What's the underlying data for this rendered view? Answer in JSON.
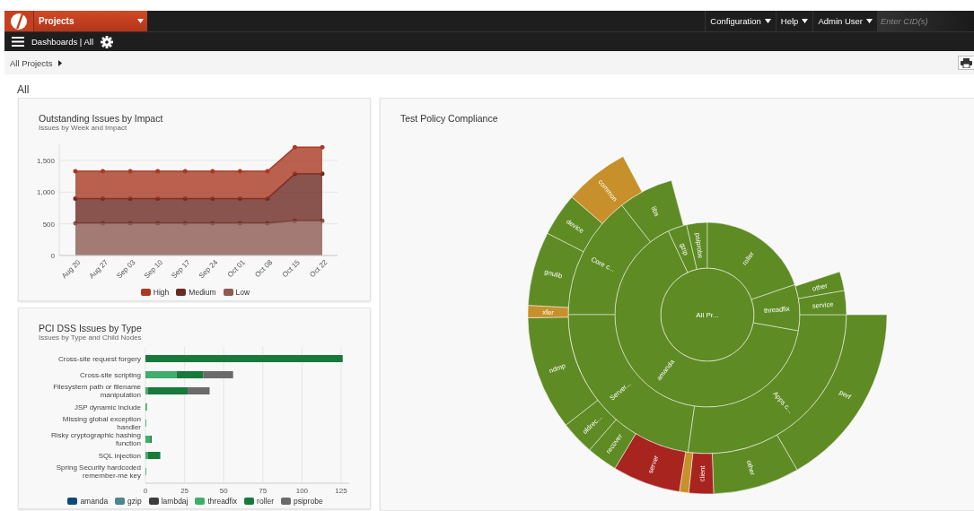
{
  "topbar": {
    "project_menu": "Projects",
    "menus": [
      "Configuration",
      "Help",
      "Admin User"
    ],
    "cid_field": {
      "placeholder": "Enter CID(s)"
    }
  },
  "subbar": {
    "title": "Dashboards | All"
  },
  "breadcrumb": {
    "label": "All Projects"
  },
  "page_title": "All",
  "impact_panel": {
    "title": "Outstanding Issues by Impact",
    "subtitle": "Issues by Week and Impact",
    "chart_data": {
      "type": "area",
      "stacked": true,
      "grid": true,
      "legend": "bottom",
      "categories": [
        "Aug 20",
        "Aug 27",
        "Sep 03",
        "Sep 10",
        "Sep 17",
        "Sep 24",
        "Oct 01",
        "Oct 08",
        "Oct 15",
        "Oct 22"
      ],
      "ylim": [
        0,
        1750
      ],
      "yticks": [
        0,
        {
          "value": 500,
          "label": "500"
        },
        {
          "value": 1000,
          "label": "1,000"
        },
        {
          "value": 1500,
          "label": "1,500"
        }
      ],
      "series": [
        {
          "name": "High",
          "color": "#a93a24",
          "values": [
            430,
            430,
            430,
            430,
            430,
            430,
            430,
            430,
            420,
            420
          ]
        },
        {
          "name": "Medium",
          "color": "#6b2b22",
          "values": [
            390,
            390,
            390,
            390,
            390,
            390,
            390,
            390,
            740,
            740
          ]
        },
        {
          "name": "Low",
          "color": "#8e5a52",
          "values": [
            510,
            510,
            510,
            510,
            510,
            510,
            510,
            510,
            550,
            550
          ]
        }
      ]
    }
  },
  "pci_panel": {
    "title": "PCI DSS Issues by Type",
    "subtitle": "Issues by Type and Child Nodes",
    "chart_data": {
      "type": "bar",
      "orientation": "horizontal",
      "stacked": true,
      "grid": true,
      "legend": "bottom",
      "categories": [
        "Cross-site request forgery",
        "Cross-site scripting",
        "Filesystem path or filename manipulation",
        "JSP dynamic include",
        "Missing global exception handler",
        "Risky cryptographic hashing function",
        "SQL injection",
        "Spring Security hardcoded remember-me key"
      ],
      "xlim": [
        0,
        130
      ],
      "xticks": [
        0,
        25,
        50,
        75,
        100,
        125
      ],
      "series": [
        {
          "name": "amanda",
          "color": "#0d4a7a",
          "values": [
            0,
            0,
            0,
            0,
            0,
            0,
            0,
            0
          ]
        },
        {
          "name": "gzip",
          "color": "#4f8590",
          "values": [
            0,
            0,
            0,
            0,
            0,
            0,
            0,
            0
          ]
        },
        {
          "name": "lambdaj",
          "color": "#3c3c3c",
          "values": [
            0,
            0,
            0,
            0,
            0,
            0,
            0,
            0
          ]
        },
        {
          "name": "threadfix",
          "color": "#3fae6a",
          "values": [
            0,
            20,
            1.5,
            1,
            0.5,
            3,
            1.5,
            0.5
          ]
        },
        {
          "name": "roller",
          "color": "#177a3b",
          "values": [
            126,
            17,
            25.5,
            0,
            0,
            1,
            8,
            0
          ]
        },
        {
          "name": "psiprobe",
          "color": "#6b6b6b",
          "values": [
            0,
            19,
            14,
            0,
            0,
            0,
            0,
            0
          ]
        }
      ]
    }
  },
  "compliance_panel": {
    "title": "Test Policy Compliance",
    "segments": [
      {
        "label": "All Pr...",
        "color": "#5e8b24"
      },
      {
        "label": "amanda",
        "color": "#5e8b24"
      },
      {
        "label": "gzip",
        "color": "#5e8b24"
      },
      {
        "label": "psiprobe",
        "color": "#5e8b24"
      },
      {
        "label": "roller",
        "color": "#5e8b24"
      },
      {
        "label": "threadfix",
        "color": "#5e8b24"
      },
      {
        "label": "Core c...",
        "color": "#5e8b24"
      },
      {
        "label": "libs",
        "color": "#5e8b24"
      },
      {
        "label": "Server...",
        "color": "#5e8b24"
      },
      {
        "label": "Apps c...",
        "color": "#5e8b24"
      },
      {
        "label": "other",
        "color": "#5e8b24"
      },
      {
        "label": "service",
        "color": "#5e8b24"
      },
      {
        "label": "perf",
        "color": "#5e8b24"
      },
      {
        "label": "other",
        "color": "#5e8b24"
      },
      {
        "label": "client",
        "color": "#a8241f"
      },
      {
        "color": "#c8902a"
      },
      {
        "label": "server",
        "color": "#a8241f"
      },
      {
        "label": "recover",
        "color": "#5e8b24"
      },
      {
        "label": "oldrec...",
        "color": "#5e8b24"
      },
      {
        "label": "ndmp",
        "color": "#5e8b24"
      },
      {
        "label": "xfer",
        "color": "#c8902a"
      },
      {
        "label": "gnulib",
        "color": "#5e8b24"
      },
      {
        "label": "device",
        "color": "#5e8b24"
      },
      {
        "label": "common",
        "color": "#c8902a"
      }
    ]
  }
}
